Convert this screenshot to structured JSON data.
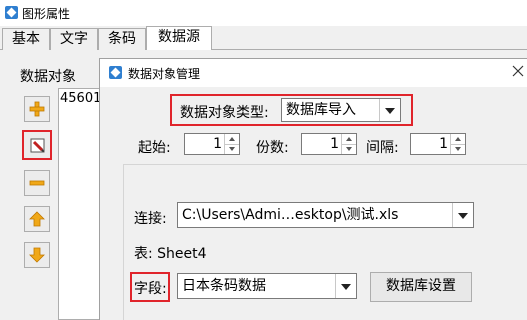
{
  "window": {
    "title": "图形属性"
  },
  "tabs": [
    {
      "label": "基本"
    },
    {
      "label": "文字"
    },
    {
      "label": "条码"
    },
    {
      "label": "数据源"
    }
  ],
  "left_panel": {
    "objects_label": "数据对象",
    "list_items": [
      "45601"
    ]
  },
  "dialog": {
    "title": "数据对象管理",
    "close": "X",
    "type_label": "数据对象类型:",
    "type_value": "数据库导入",
    "start_label": "起始:",
    "start_value": "1",
    "copies_label": "份数:",
    "copies_value": "1",
    "interval_label": "间隔:",
    "interval_value": "1",
    "connection_label": "连接:",
    "connection_value": "C:\\Users\\Admi…esktop\\测试.xls",
    "table_label": "表: Sheet4",
    "field_label": "字段:",
    "field_value": "日本条码数据",
    "db_settings_button": "数据库设置"
  },
  "colors": {
    "highlight_red": "#e0242b",
    "add_icon": "#f0a818",
    "edit_icon": "#c02020"
  }
}
